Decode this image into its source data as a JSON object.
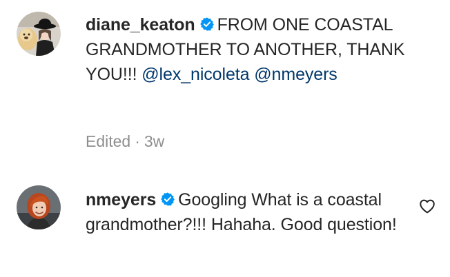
{
  "comments": [
    {
      "username": "diane_keaton",
      "verified": true,
      "text": "FROM ONE COASTAL GRANDMOTHER TO ANOTHER, THANK YOU!!!",
      "mentions": [
        "@lex_nicoleta",
        "@nmeyers"
      ],
      "edited_label": "Edited",
      "separator": "·",
      "timestamp": "3w"
    },
    {
      "username": "nmeyers",
      "verified": true,
      "text": "Googling What is a coastal grandmother?!!! Hahaha. Good question!",
      "like_icon": "heart-outline-icon"
    }
  ],
  "colors": {
    "text": "#262626",
    "mention": "#00376b",
    "secondary": "#8e8e8e",
    "verified": "#0095f6"
  }
}
